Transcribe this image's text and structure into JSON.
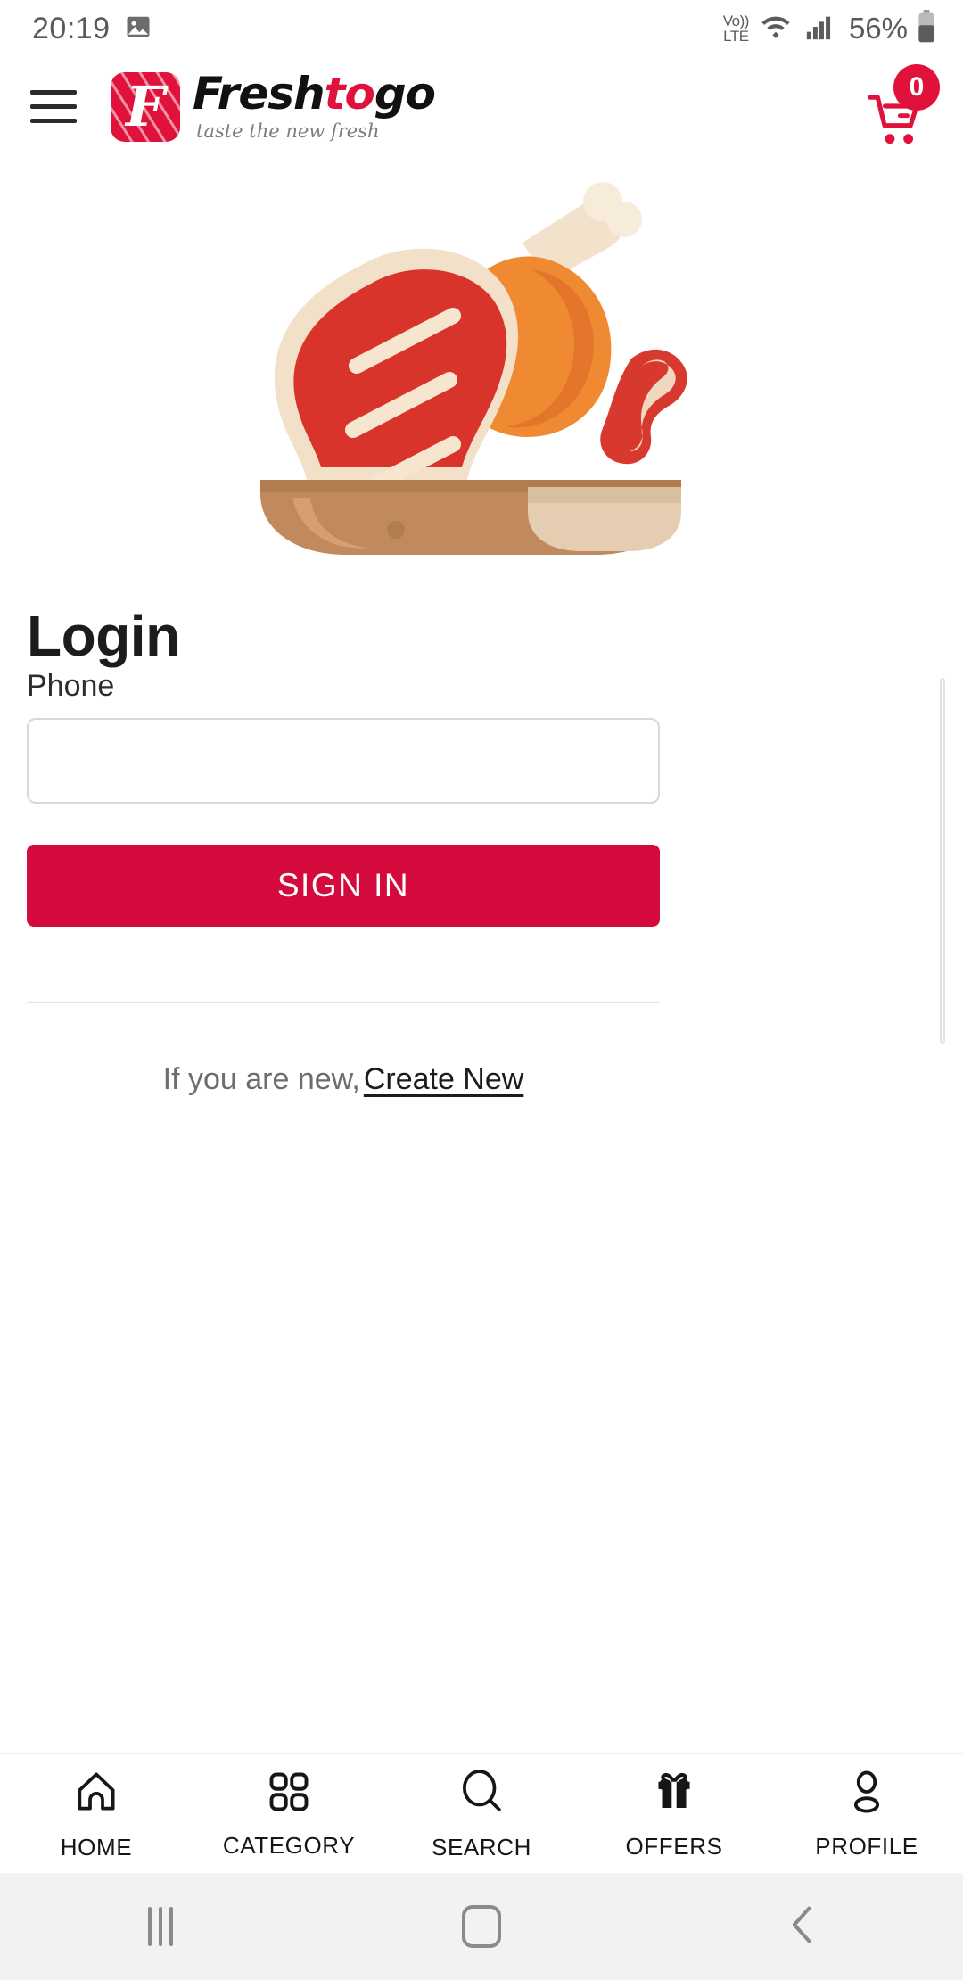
{
  "status_bar": {
    "time": "20:19",
    "photo_icon": "image-icon",
    "volte_top": "Vo))",
    "volte_bottom": "LTE",
    "wifi_icon": "wifi-icon",
    "signal_icon": "cellular-signal-icon",
    "battery_percent": "56%",
    "battery_icon": "battery-icon"
  },
  "header": {
    "menu_icon": "hamburger-menu-icon",
    "logo_letter": "F",
    "brand_part1": "Fresh",
    "brand_accent": "to",
    "brand_part3": "go",
    "tagline": "taste the new fresh",
    "cart_icon": "shopping-cart-icon",
    "cart_count": "0"
  },
  "hero": {
    "illustration": "meat-platter-illustration"
  },
  "login": {
    "title": "Login",
    "phone_label": "Phone",
    "phone_value": "",
    "phone_placeholder": "",
    "signin_label": "SIGN IN",
    "signup_prompt": "If you are new,",
    "signup_link": "Create New"
  },
  "bottom_nav": {
    "items": [
      {
        "label": "HOME",
        "icon": "home-icon"
      },
      {
        "label": "CATEGORY",
        "icon": "grid-icon"
      },
      {
        "label": "SEARCH",
        "icon": "search-icon"
      },
      {
        "label": "OFFERS",
        "icon": "gift-icon"
      },
      {
        "label": "PROFILE",
        "icon": "person-icon"
      }
    ]
  },
  "system_nav": {
    "recents": "recents-icon",
    "home": "home-square-icon",
    "back": "back-chevron-icon"
  },
  "colors": {
    "brand_red": "#e0123c",
    "button_red": "#d40a3c",
    "text_dark": "#1c1c1c",
    "text_muted": "#6d6d6d"
  }
}
